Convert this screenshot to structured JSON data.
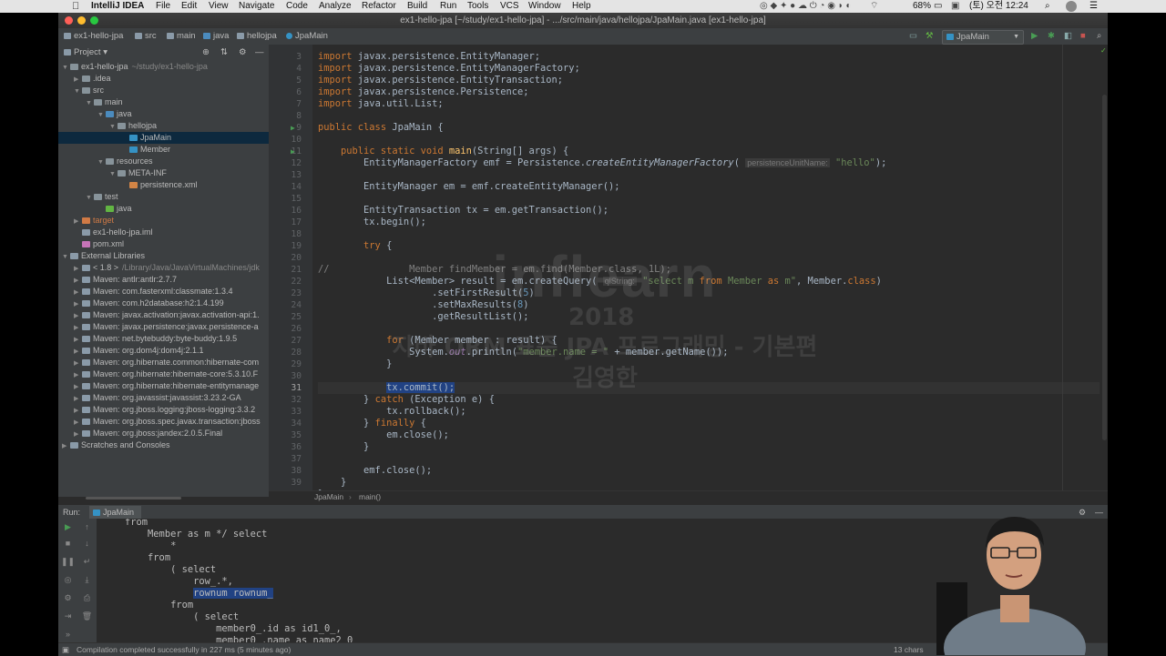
{
  "menubar": {
    "app": "IntelliJ IDEA",
    "items": [
      "File",
      "Edit",
      "View",
      "Navigate",
      "Code",
      "Analyze",
      "Refactor",
      "Build",
      "Run",
      "Tools",
      "VCS",
      "Window",
      "Help"
    ],
    "battery": "68%",
    "clock": "(토) 오전 12:24"
  },
  "window": {
    "title": "ex1-hello-jpa [~/study/ex1-hello-jpa] - .../src/main/java/hellojpa/JpaMain.java [ex1-hello-jpa]"
  },
  "navbar": {
    "crumbs": [
      "ex1-hello-jpa",
      "src",
      "main",
      "java",
      "hellojpa",
      "JpaMain"
    ],
    "run_config": "JpaMain"
  },
  "project": {
    "header": "Project",
    "tree": [
      {
        "label": "ex1-hello-jpa",
        "suffix": "~/study/ex1-hello-jpa",
        "depth": 0,
        "arrow": "▼",
        "color": "#87939a"
      },
      {
        "label": ".idea",
        "depth": 1,
        "arrow": "▶",
        "color": "#87939a"
      },
      {
        "label": "src",
        "depth": 1,
        "arrow": "▼",
        "color": "#87939a"
      },
      {
        "label": "main",
        "depth": 2,
        "arrow": "▼",
        "color": "#87939a"
      },
      {
        "label": "java",
        "depth": 3,
        "arrow": "▼",
        "color": "#4b8bbe"
      },
      {
        "label": "hellojpa",
        "depth": 4,
        "arrow": "▼",
        "color": "#87939a"
      },
      {
        "label": "JpaMain",
        "depth": 5,
        "arrow": "",
        "color": "#3592c4",
        "selected": true
      },
      {
        "label": "Member",
        "depth": 5,
        "arrow": "",
        "color": "#3592c4"
      },
      {
        "label": "resources",
        "depth": 3,
        "arrow": "▼",
        "color": "#87939a"
      },
      {
        "label": "META-INF",
        "depth": 4,
        "arrow": "▼",
        "color": "#87939a"
      },
      {
        "label": "persistence.xml",
        "depth": 5,
        "arrow": "",
        "color": "#d28445"
      },
      {
        "label": "test",
        "depth": 2,
        "arrow": "▼",
        "color": "#87939a"
      },
      {
        "label": "java",
        "depth": 3,
        "arrow": "",
        "color": "#62b543"
      },
      {
        "label": "target",
        "depth": 1,
        "arrow": "▶",
        "color": "#d07a45"
      },
      {
        "label": "ex1-hello-jpa.iml",
        "depth": 1,
        "arrow": "",
        "color": "#8a9aa8"
      },
      {
        "label": "pom.xml",
        "depth": 1,
        "arrow": "",
        "color": "#c774b8"
      },
      {
        "label": "External Libraries",
        "depth": 0,
        "arrow": "▼",
        "color": "#8a9aa8"
      },
      {
        "label": "< 1.8 >",
        "suffix": "/Library/Java/JavaVirtualMachines/jdk",
        "depth": 1,
        "arrow": "▶",
        "color": "#8a9aa8"
      },
      {
        "label": "Maven: antlr:antlr:2.7.7",
        "depth": 1,
        "arrow": "▶",
        "color": "#8a9aa8"
      },
      {
        "label": "Maven: com.fasterxml:classmate:1.3.4",
        "depth": 1,
        "arrow": "▶",
        "color": "#8a9aa8"
      },
      {
        "label": "Maven: com.h2database:h2:1.4.199",
        "depth": 1,
        "arrow": "▶",
        "color": "#8a9aa8"
      },
      {
        "label": "Maven: javax.activation:javax.activation-api:1.",
        "depth": 1,
        "arrow": "▶",
        "color": "#8a9aa8"
      },
      {
        "label": "Maven: javax.persistence:javax.persistence-a",
        "depth": 1,
        "arrow": "▶",
        "color": "#8a9aa8"
      },
      {
        "label": "Maven: net.bytebuddy:byte-buddy:1.9.5",
        "depth": 1,
        "arrow": "▶",
        "color": "#8a9aa8"
      },
      {
        "label": "Maven: org.dom4j:dom4j:2.1.1",
        "depth": 1,
        "arrow": "▶",
        "color": "#8a9aa8"
      },
      {
        "label": "Maven: org.hibernate.common:hibernate-com",
        "depth": 1,
        "arrow": "▶",
        "color": "#8a9aa8"
      },
      {
        "label": "Maven: org.hibernate:hibernate-core:5.3.10.F",
        "depth": 1,
        "arrow": "▶",
        "color": "#8a9aa8"
      },
      {
        "label": "Maven: org.hibernate:hibernate-entitymanage",
        "depth": 1,
        "arrow": "▶",
        "color": "#8a9aa8"
      },
      {
        "label": "Maven: org.javassist:javassist:3.23.2-GA",
        "depth": 1,
        "arrow": "▶",
        "color": "#8a9aa8"
      },
      {
        "label": "Maven: org.jboss.logging:jboss-logging:3.3.2",
        "depth": 1,
        "arrow": "▶",
        "color": "#8a9aa8"
      },
      {
        "label": "Maven: org.jboss.spec.javax.transaction:jboss",
        "depth": 1,
        "arrow": "▶",
        "color": "#8a9aa8"
      },
      {
        "label": "Maven: org.jboss:jandex:2.0.5.Final",
        "depth": 1,
        "arrow": "▶",
        "color": "#8a9aa8"
      },
      {
        "label": "Scratches and Consoles",
        "depth": 0,
        "arrow": "▶",
        "color": "#8a9aa8"
      }
    ]
  },
  "editor": {
    "line_numbers": [
      "3",
      "4",
      "5",
      "6",
      "7",
      "8",
      "9",
      "10",
      "11",
      "12",
      "13",
      "14",
      "15",
      "16",
      "17",
      "18",
      "19",
      "20",
      "21",
      "22",
      "23",
      "24",
      "25",
      "26",
      "27",
      "28",
      "29",
      "30",
      "31",
      "32",
      "33",
      "34",
      "35",
      "36",
      "37",
      "38",
      "39",
      "40"
    ],
    "run_marks": [
      "9",
      "11"
    ],
    "lines": [
      [
        {
          "t": "import ",
          "c": "kw"
        },
        {
          "t": "javax.persistence.EntityManager;"
        }
      ],
      [
        {
          "t": "import ",
          "c": "kw"
        },
        {
          "t": "javax.persistence.EntityManagerFactory;"
        }
      ],
      [
        {
          "t": "import ",
          "c": "kw"
        },
        {
          "t": "javax.persistence.EntityTransaction;"
        }
      ],
      [
        {
          "t": "import ",
          "c": "kw"
        },
        {
          "t": "javax.persistence.Persistence;"
        }
      ],
      [
        {
          "t": "import ",
          "c": "kw"
        },
        {
          "t": "java.util.List;"
        }
      ],
      [],
      [
        {
          "t": "public class ",
          "c": "kw"
        },
        {
          "t": "JpaMain {"
        }
      ],
      [],
      [
        {
          "t": "    "
        },
        {
          "t": "public static void ",
          "c": "kw"
        },
        {
          "t": "main",
          "c": "fn"
        },
        {
          "t": "(String[] args) {"
        }
      ],
      [
        {
          "t": "        EntityManagerFactory emf = Persistence."
        },
        {
          "t": "createEntityManagerFactory",
          "c": "it"
        },
        {
          "t": "( "
        },
        {
          "t": "persistenceUnitName:",
          "c": "hint"
        },
        {
          "t": " "
        },
        {
          "t": "\"hello\"",
          "c": "str"
        },
        {
          "t": ");"
        }
      ],
      [],
      [
        {
          "t": "        EntityManager em = emf.createEntityManager();"
        }
      ],
      [],
      [
        {
          "t": "        EntityTransaction tx = em.getTransaction();"
        }
      ],
      [
        {
          "t": "        tx.begin();"
        }
      ],
      [],
      [
        {
          "t": "        "
        },
        {
          "t": "try ",
          "c": "kw"
        },
        {
          "t": "{"
        }
      ],
      [],
      [
        {
          "t": "//              Member findMember = em.find(Member.class, 1L);",
          "c": "cm"
        }
      ],
      [
        {
          "t": "            List<Member> result = em.createQuery( "
        },
        {
          "t": "qlString:",
          "c": "hint"
        },
        {
          "t": " "
        },
        {
          "t": "\"select m ",
          "c": "str"
        },
        {
          "t": "from ",
          "c": "kw"
        },
        {
          "t": "Member ",
          "c": "str"
        },
        {
          "t": "as ",
          "c": "kw"
        },
        {
          "t": "m\"",
          "c": "str"
        },
        {
          "t": ", Member."
        },
        {
          "t": "class",
          "c": "kw"
        },
        {
          "t": ")"
        }
      ],
      [
        {
          "t": "                    .setFirstResult("
        },
        {
          "t": "5",
          "c": "num"
        },
        {
          "t": ")"
        }
      ],
      [
        {
          "t": "                    .setMaxResults("
        },
        {
          "t": "8",
          "c": "num"
        },
        {
          "t": ")"
        }
      ],
      [
        {
          "t": "                    .getResultList();"
        }
      ],
      [],
      [
        {
          "t": "            "
        },
        {
          "t": "for ",
          "c": "kw"
        },
        {
          "t": "(Member member : result) {"
        }
      ],
      [
        {
          "t": "                System."
        },
        {
          "t": "out",
          "c": "fld"
        },
        {
          "t": ".println("
        },
        {
          "t": "\"member.name = \"",
          "c": "str"
        },
        {
          "t": " + member.getName());"
        }
      ],
      [
        {
          "t": "            }"
        }
      ],
      [],
      [
        {
          "t": "            "
        },
        {
          "t": "tx.commit();",
          "c": "selc"
        }
      ],
      [
        {
          "t": "        } "
        },
        {
          "t": "catch ",
          "c": "kw"
        },
        {
          "t": "(Exception e) {"
        }
      ],
      [
        {
          "t": "            tx.rollback();"
        }
      ],
      [
        {
          "t": "        } "
        },
        {
          "t": "finally ",
          "c": "kw"
        },
        {
          "t": "{"
        }
      ],
      [
        {
          "t": "            em.close();"
        }
      ],
      [
        {
          "t": "        }"
        }
      ],
      [],
      [
        {
          "t": "        emf.close();"
        }
      ],
      [
        {
          "t": "    }"
        }
      ],
      [
        {
          "t": "}"
        }
      ]
    ],
    "breadcrumb": [
      "JpaMain",
      "main()"
    ]
  },
  "watermark": {
    "line1": "inflearn",
    "line2": "2018",
    "line3": "자바 ORM 표준 JPA 프로그래밍 - 기본편",
    "line4": "김영한"
  },
  "run_panel": {
    "label": "Run:",
    "tab": "JpaMain",
    "output": [
      "    from",
      "        Member as m */ select",
      "            *",
      "        from",
      "            ( select",
      "                row_.*,",
      "                rownum rownum_",
      "            from",
      "                ( select",
      "                    member0_.id as id1_0_,",
      "                    member0_.name as name2_0"
    ]
  },
  "status": {
    "message": "Compilation completed successfully in 227 ms (5 minutes ago)",
    "chars": "13 chars"
  }
}
